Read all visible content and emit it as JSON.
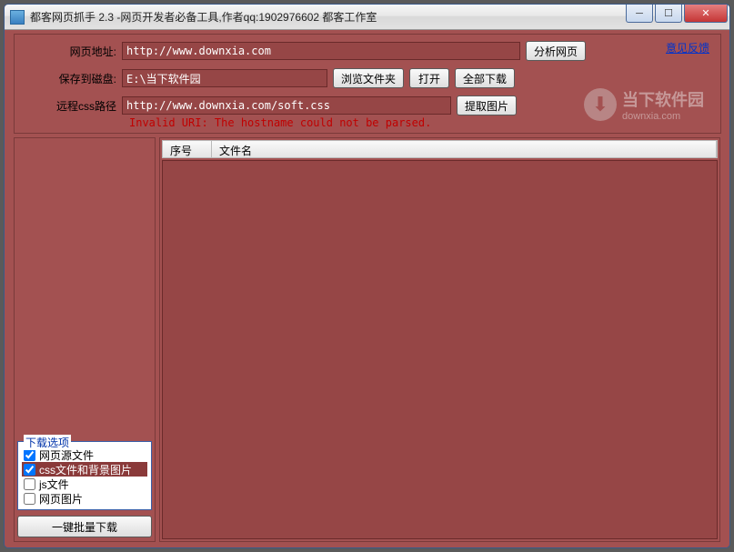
{
  "window": {
    "title": "都客网页抓手 2.3 -网页开发者必备工具,作者qq:1902976602 都客工作室"
  },
  "feedback": "意见反馈",
  "form": {
    "url_label": "网页地址:",
    "url_value": "http://www.downxia.com",
    "analyze_btn": "分析网页",
    "save_label": "保存到磁盘:",
    "save_value": "E:\\当下软件园",
    "browse_btn": "浏览文件夹",
    "open_btn": "打开",
    "download_all_btn": "全部下载",
    "css_label": "远程css路径",
    "css_value": "http://www.downxia.com/soft.css",
    "extract_img_btn": "提取图片",
    "error": "Invalid URI: The hostname could not be parsed."
  },
  "watermark": {
    "line1": "当下软件园",
    "line2": "downxia.com"
  },
  "options": {
    "legend": "下载选项",
    "opt1": "网页源文件",
    "opt2": "css文件和背景图片",
    "opt3": "js文件",
    "opt4": "网页图片"
  },
  "bulk_button": "一键批量下载",
  "columns": {
    "seq": "序号",
    "name": "文件名"
  }
}
